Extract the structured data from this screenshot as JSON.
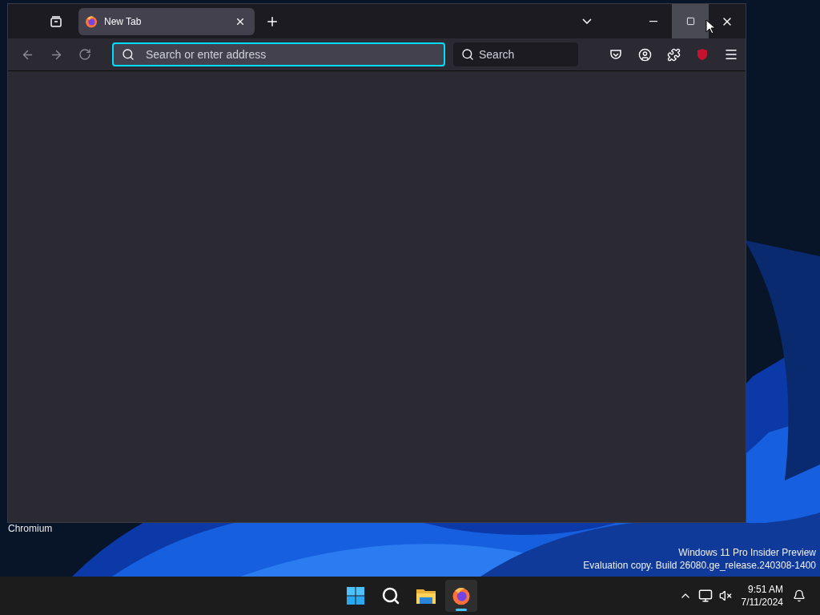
{
  "desktop": {
    "icons": [
      {
        "label": "Chromium"
      }
    ],
    "watermark": [
      "Windows 11 Pro Insider Preview",
      "Evaluation copy. Build 26080.ge_release.240308-1400"
    ]
  },
  "window": {
    "tabs": [
      {
        "title": "New Tab",
        "selected": true
      }
    ],
    "address_bar": {
      "placeholder": "Search or enter address",
      "focused": true
    },
    "search_box": {
      "placeholder": "Search"
    },
    "maximize_hovered": true
  },
  "taskbar": {
    "apps": [
      {
        "kind": "start",
        "active": false
      },
      {
        "kind": "search",
        "active": false
      },
      {
        "kind": "files",
        "active": false
      },
      {
        "kind": "browser",
        "active": true
      }
    ],
    "clock": {
      "time": "9:51 AM",
      "date": "7/11/2024"
    }
  }
}
